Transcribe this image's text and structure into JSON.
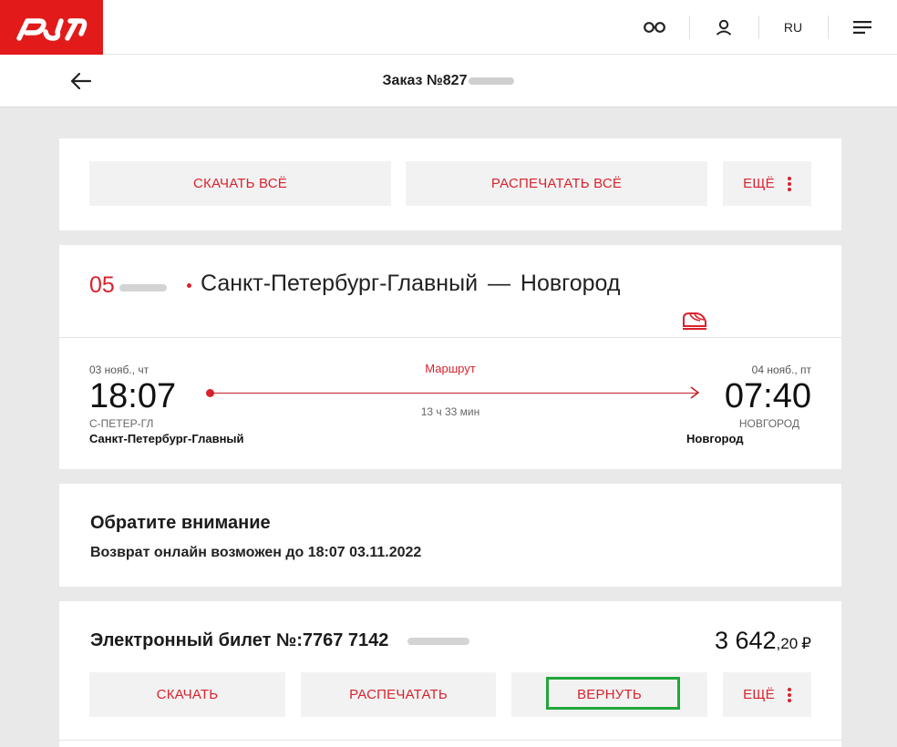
{
  "header": {
    "lang": "RU"
  },
  "order": {
    "title": "Заказ №827"
  },
  "actions": {
    "download_all": "СКАЧАТЬ ВСЁ",
    "print_all": "РАСПЕЧАТАТЬ ВСЁ",
    "more": "ЕЩЁ"
  },
  "trip": {
    "train_number": "05",
    "route": "Санкт-Петербург-Главный —  Новгород",
    "departure": {
      "date": "03 нояб., чт",
      "time": "18:07",
      "code": "С-ПЕТЕР-ГЛ",
      "station": "Санкт-Петербург-Главный"
    },
    "arrival": {
      "date": "04 нояб., пт",
      "time": "07:40",
      "code": "НОВГОРОД",
      "station": "Новгород"
    },
    "route_link": "Маршрут",
    "duration": "13 ч 33 мин"
  },
  "notice": {
    "title": "Обратите внимание",
    "text": "Возврат онлайн возможен до 18:07 03.11.2022"
  },
  "ticket": {
    "title": "Электронный билет №:7767 7142",
    "price_main": "3 642",
    "price_cents": ",20",
    "currency": "₽",
    "download": "СКАЧАТЬ",
    "print": "РАСПЕЧАТАТЬ",
    "refund": "ВЕРНУТЬ",
    "more": "ЕЩЁ"
  },
  "colors": {
    "brand_red": "#e21a1a",
    "accent_red": "#d9232e",
    "highlight_green": "#22a63a"
  }
}
